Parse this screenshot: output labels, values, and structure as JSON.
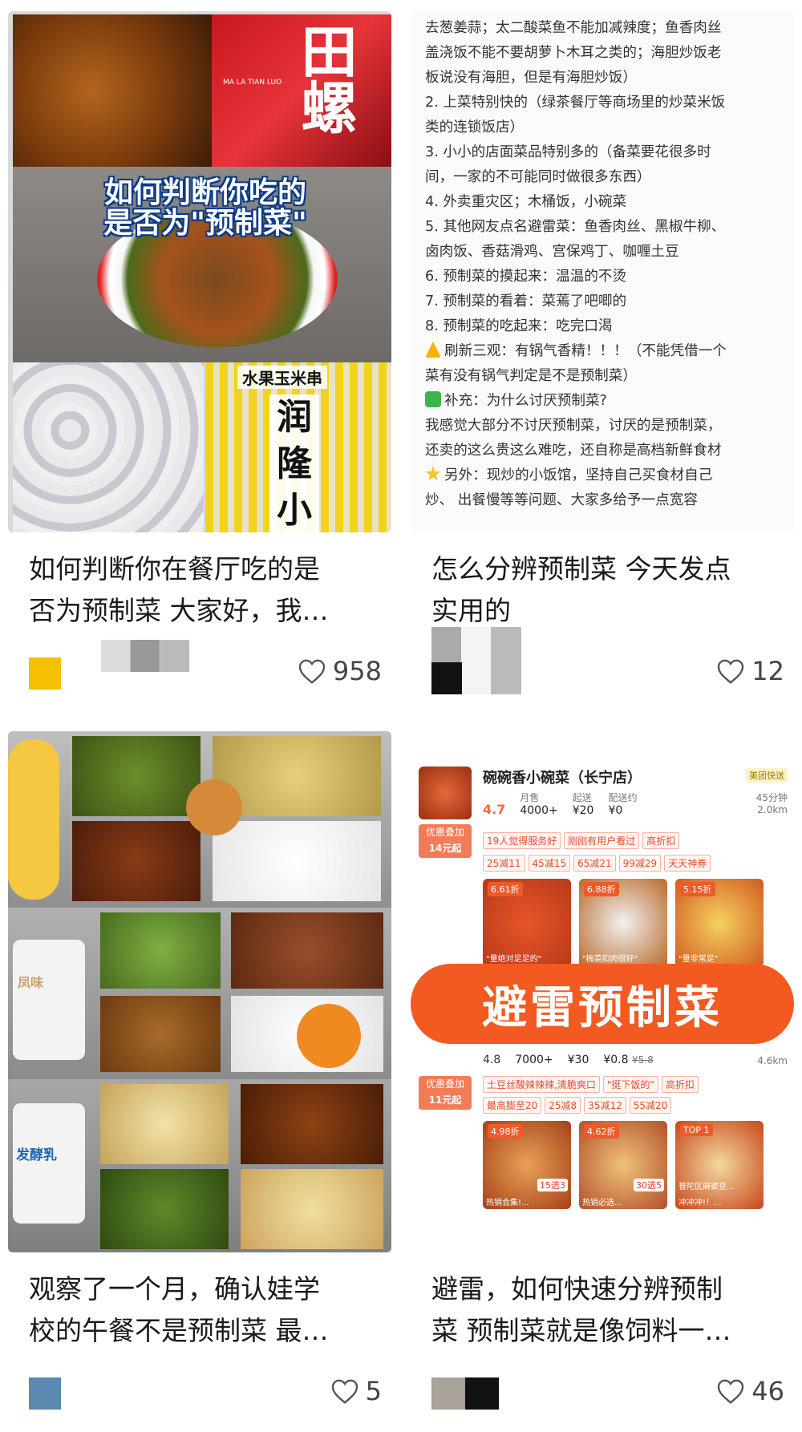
{
  "cards": [
    {
      "overlay_title": [
        "如何判断你吃的",
        "是否为\"预制菜\""
      ],
      "image_texts": [
        "田螺",
        "MA LA TIAN LUO",
        "水果玉米串",
        "润",
        "隆",
        "小"
      ],
      "title_lines": [
        "如何判断你在餐厅吃的是",
        "否为预制菜 大家好，我…"
      ],
      "likes": "958",
      "avatar_color": "#f5c000"
    },
    {
      "note_lines": [
        "去葱姜蒜；太二酸菜鱼不能加减辣度；鱼香肉丝",
        "盖浇饭不能不要胡萝卜木耳之类的；海胆炒饭老",
        "板说没有海胆，但是有海胆炒饭）",
        "2. 上菜特别快的（绿茶餐厅等商场里的炒菜米饭",
        "类的连锁饭店）",
        "3. 小小的店面菜品特别多的（备菜要花很多时",
        "间，一家的不可能同时做很多东西）",
        "4. 外卖重灾区；木桶饭，小碗菜",
        "5. 其他网友点名避雷菜：鱼香肉丝、黑椒牛柳、",
        "卤肉饭、香菇滑鸡、宫保鸡丁、咖喱土豆",
        "6. 预制菜的摸起来：温温的不烫",
        "7. 预制菜的看着：菜蔫了吧唧的",
        "8. 预制菜的吃起来：吃完口渴",
        "刷新三观：有锅气香精！！！（不能凭借一个",
        "菜有没有锅气判定是不是预制菜）",
        "补充：为什么讨厌预制菜?",
        "我感觉大部分不讨厌预制菜，讨厌的是预制菜，",
        "还卖的这么贵这么难吃，还自称是高档新鲜食材",
        "另外：现炒的小饭馆，坚持自己买食材自己",
        "炒、 出餐慢等等问题、大家多给予一点宽容"
      ],
      "title_lines": [
        "怎么分辨预制菜 今天发点",
        "实用的"
      ],
      "likes": "12"
    },
    {
      "image_texts": [
        "发酵乳",
        "凤味"
      ],
      "title_lines": [
        "观察了一个月，确认娃学",
        "校的午餐不是预制菜 最…"
      ],
      "likes": "5",
      "avatar_color": "#5b89b0"
    },
    {
      "shop": {
        "name": "碗碗香小碗菜（长宁店）",
        "badge": "美团快送",
        "rating": "4.7",
        "sales_label": "月售",
        "sales": "4000+",
        "min_label": "起送",
        "min": "¥20",
        "fee_label": "配送约",
        "fee": "¥0",
        "time": "45分钟",
        "dist": "2.0km",
        "promo": "优惠叠加",
        "promo2": "14元起",
        "tags": [
          "19人觉得服务好",
          "刚刚有用户看过",
          "高折扣"
        ],
        "coupons": [
          "25减11",
          "45减15",
          "65减21",
          "99减29",
          "天天神券"
        ],
        "tiles": [
          {
            "disc": "6.61折",
            "cap": "\"量绝对足足的\""
          },
          {
            "disc": "6.88折",
            "cap": "\"梅菜扣肉很好\""
          },
          {
            "disc": "5.15折",
            "cap": "\"量非常足\""
          }
        ]
      },
      "stamp": "避雷预制菜",
      "shop2": {
        "rating": "4.8",
        "sales": "7000+",
        "min": "¥30",
        "fee": "¥0.8",
        "fee_old": "¥5.8",
        "dist": "4.6km",
        "promo": "优惠叠加",
        "promo2": "11元起",
        "tags": [
          "土豆丝酸辣辣辣,清脆爽口",
          "\"挺下饭的\"",
          "高折扣"
        ],
        "coupons": [
          "最高膨至20",
          "25减8",
          "35减12",
          "55减20"
        ],
        "tiles": [
          {
            "disc": "4.98折",
            "cap": "热销合集!...",
            "badge": "15选3"
          },
          {
            "disc": "4.62折",
            "cap": "热销必选...",
            "badge": "30选5"
          },
          {
            "disc": "TOP 1",
            "cap": "冲冲冲!！...",
            "badge": "普陀区麻婆豆..."
          }
        ]
      },
      "title_lines": [
        "避雷，如何快速分辨预制",
        "菜 预制菜就是像饲料一…"
      ],
      "likes": "46"
    }
  ],
  "colors": {
    "heart": "#555555",
    "accent": "#f25a22"
  }
}
